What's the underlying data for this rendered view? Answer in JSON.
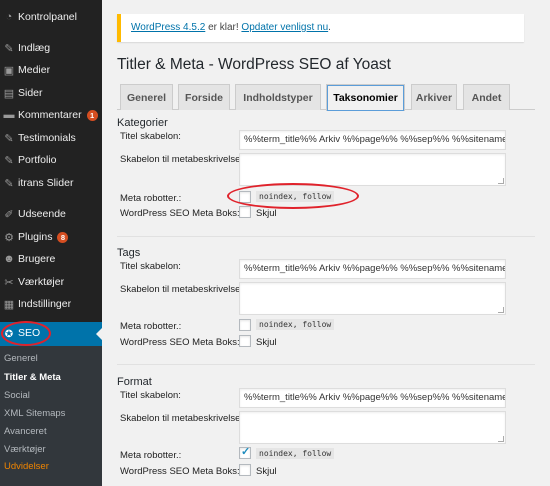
{
  "sidebar": {
    "items": [
      {
        "label": "Kontrolpanel",
        "icon": "dashboard-icon",
        "glyph": "◔"
      },
      {
        "label": "Indlæg",
        "icon": "pin-icon",
        "glyph": "✎"
      },
      {
        "label": "Medier",
        "icon": "media-icon",
        "glyph": "▣"
      },
      {
        "label": "Sider",
        "icon": "pages-icon",
        "glyph": "▤"
      },
      {
        "label": "Kommentarer",
        "icon": "comments-icon",
        "glyph": "▬",
        "badge": "1"
      },
      {
        "label": "Testimonials",
        "icon": "testimonials-icon",
        "glyph": "✎"
      },
      {
        "label": "Portfolio",
        "icon": "portfolio-icon",
        "glyph": "✎"
      },
      {
        "label": "itrans Slider",
        "icon": "slider-icon",
        "glyph": "✎"
      },
      {
        "label": "Udseende",
        "icon": "appearance-icon",
        "glyph": "✐"
      },
      {
        "label": "Plugins",
        "icon": "plugins-icon",
        "glyph": "⚙",
        "badge": "8"
      },
      {
        "label": "Brugere",
        "icon": "users-icon",
        "glyph": "☻"
      },
      {
        "label": "Værktøjer",
        "icon": "tools-icon",
        "glyph": "✂"
      },
      {
        "label": "Indstillinger",
        "icon": "settings-icon",
        "glyph": "▦"
      }
    ],
    "active": {
      "label": "SEO",
      "icon": "seo-icon",
      "glyph": "✪"
    },
    "submenu": [
      "Generel",
      "Titler & Meta",
      "Social",
      "XML Sitemaps",
      "Avanceret",
      "Værktøjer",
      "Udvidelser"
    ]
  },
  "notice": {
    "version_link": "WordPress 4.5.2",
    "middle_text": " er klar! ",
    "update_link": "Opdater venligst nu",
    "end_text": "."
  },
  "page_title": "Titler & Meta - WordPress SEO af Yoast",
  "tabs": [
    "Generel",
    "Forside",
    "Indholdstyper",
    "Taksonomier",
    "Arkiver",
    "Andet"
  ],
  "active_tab": "Taksonomier",
  "labels": {
    "title_template": "Titel skabelon:",
    "meta_template": "Skabelon til metabeskrivelse:",
    "meta_robots": "Meta robotter.:",
    "meta_box": "WordPress SEO Meta Boks:",
    "hide": "Skjul",
    "noindex": "noindex, follow"
  },
  "sections": [
    {
      "title": "Kategorier",
      "title_value": "%%term_title%% Arkiv %%page%% %%sep%% %%sitename%%",
      "noindex_checked": false,
      "hide_checked": false
    },
    {
      "title": "Tags",
      "title_value": "%%term_title%% Arkiv %%page%% %%sep%% %%sitename%%",
      "noindex_checked": false,
      "hide_checked": false
    },
    {
      "title": "Format",
      "title_value": "%%term_title%% Arkiv %%page%% %%sep%% %%sitename%%",
      "noindex_checked": true,
      "hide_checked": false
    }
  ],
  "colors": {
    "accent": "#0073aa",
    "annotation": "#e0222b",
    "notice_border": "#ffba00",
    "sidebar_bg": "#222222"
  }
}
